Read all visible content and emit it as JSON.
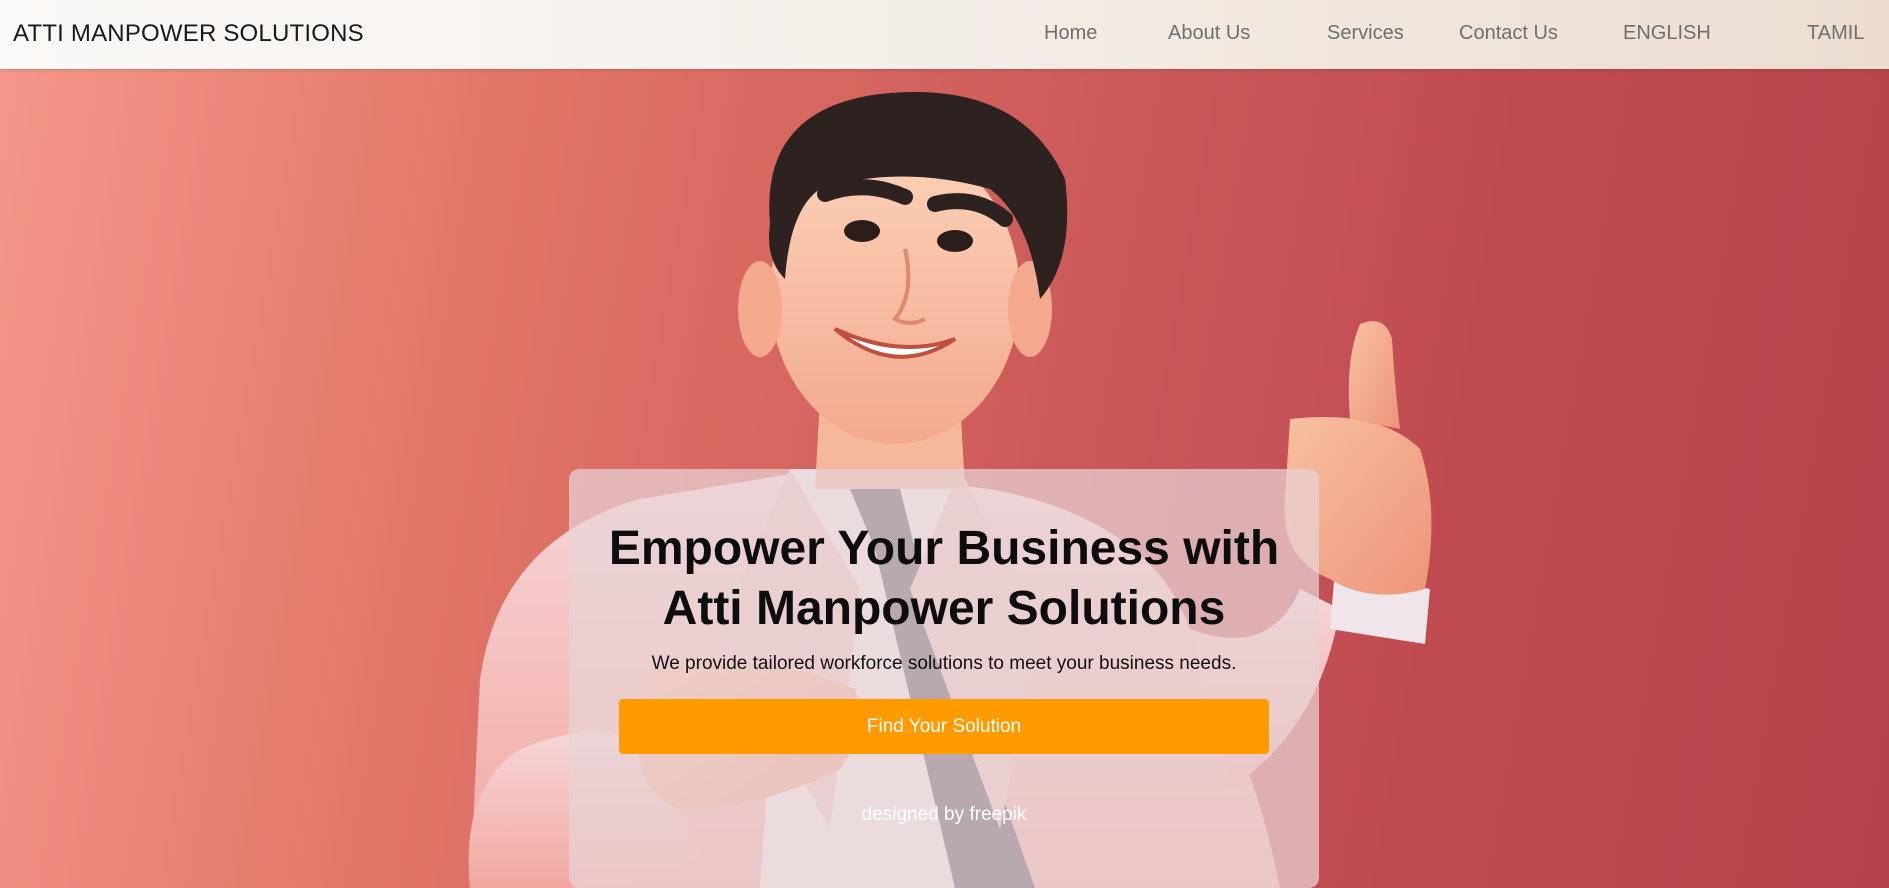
{
  "brand": "ATTI MANPOWER SOLUTIONS",
  "nav": {
    "links": [
      "Home",
      "About Us",
      "Services",
      "Contact Us",
      "ENGLISH",
      "TAMIL"
    ]
  },
  "hero": {
    "headline_line1": "Empower Your Business with",
    "headline_line2": "Atti Manpower Solutions",
    "tagline": "We provide tailored workforce solutions to meet your business needs.",
    "cta_label": "Find Your Solution",
    "credit": "designed by freepik"
  },
  "colors": {
    "accent": "#ff9a00",
    "hero_gradient_start": "#f4978a",
    "hero_gradient_end": "#b4434b",
    "nav_background": "#f4eee8"
  },
  "illustration": "thumbs-up-businessman-character"
}
